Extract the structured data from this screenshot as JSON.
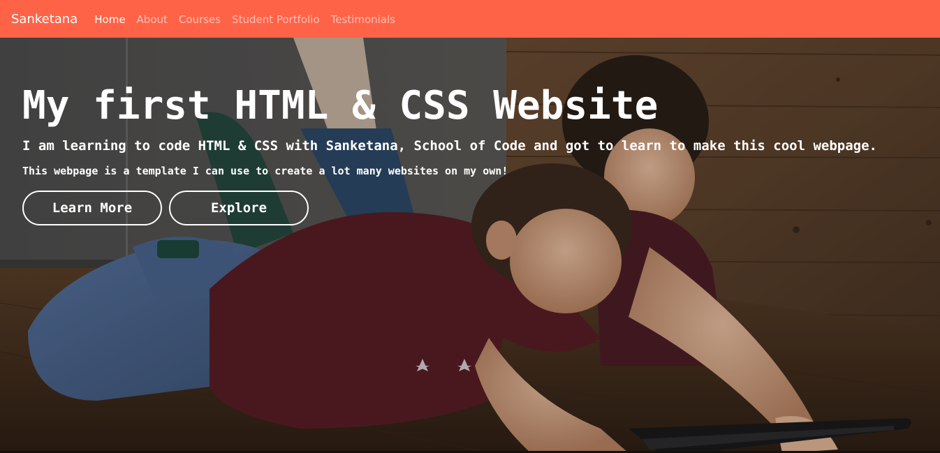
{
  "navbar": {
    "brand": "Sanketana",
    "links": [
      {
        "label": "Home",
        "active": true
      },
      {
        "label": "About",
        "active": false
      },
      {
        "label": "Courses",
        "active": false
      },
      {
        "label": "Student Portfolio",
        "active": false
      },
      {
        "label": "Testimonials",
        "active": false
      }
    ]
  },
  "hero": {
    "title": "My first HTML & CSS Website",
    "subtitle": "I am learning to code HTML & CSS with Sanketana, School of Code and got to learn to make this cool webpage.",
    "text": "This webpage is a template I can use to create a lot many websites on my own!",
    "buttons": {
      "learn_more": "Learn More",
      "explore": "Explore"
    },
    "background_image": "photo-of-two-children-lying-on-wooden-floor-using-a-tablet"
  },
  "colors": {
    "navbar": "#ff6347",
    "text": "#ffffff"
  }
}
